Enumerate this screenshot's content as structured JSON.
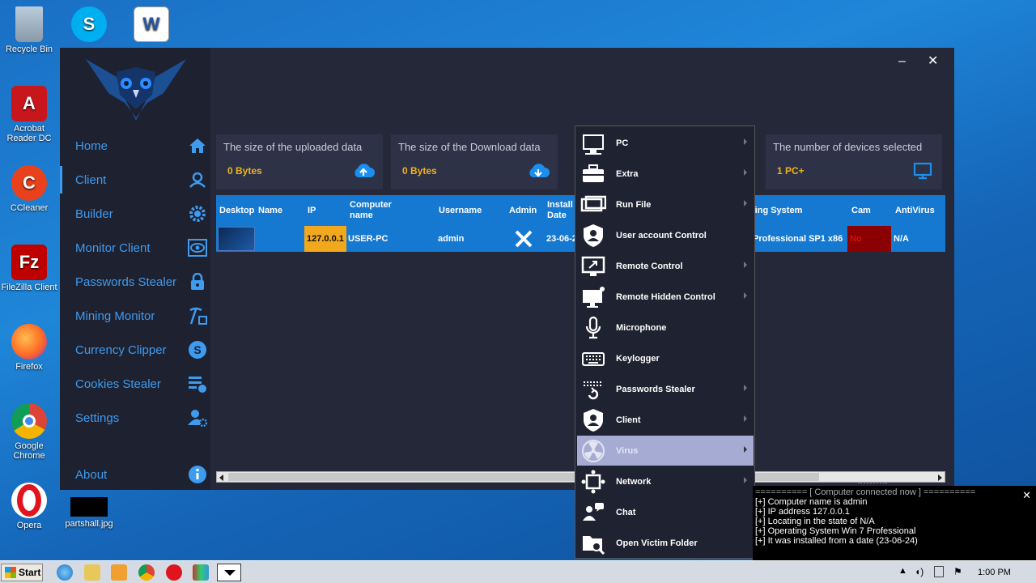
{
  "desktop": {
    "icons": [
      {
        "label": "Recycle Bin"
      },
      {
        "label": ""
      },
      {
        "label": ""
      },
      {
        "label": "Acrobat Reader DC"
      },
      {
        "label": "CCleaner"
      },
      {
        "label": "FileZilla Client"
      },
      {
        "label": "Firefox"
      },
      {
        "label": "Google Chrome"
      },
      {
        "label": "Opera"
      },
      {
        "label": "partshall.jpg"
      }
    ]
  },
  "window": {
    "minimize": "–",
    "close": "✕"
  },
  "sidebar": {
    "items": [
      {
        "label": "Home",
        "icon": "home-icon"
      },
      {
        "label": "Client",
        "icon": "user-icon"
      },
      {
        "label": "Builder",
        "icon": "gear-icon"
      },
      {
        "label": "Monitor Client",
        "icon": "eye-icon"
      },
      {
        "label": "Passwords Stealer",
        "icon": "lock-icon"
      },
      {
        "label": "Mining Monitor",
        "icon": "pickaxe-icon"
      },
      {
        "label": "Currency Clipper",
        "icon": "coin-icon"
      },
      {
        "label": "Cookies Stealer",
        "icon": "list-icon"
      },
      {
        "label": "Settings",
        "icon": "user-settings-icon"
      },
      {
        "label": "About",
        "icon": "info-icon"
      }
    ]
  },
  "stats": [
    {
      "title": "The size of the uploaded data",
      "value": "0 Bytes",
      "icon": "cloud-upload-icon"
    },
    {
      "title": "The size of the Download data",
      "value": "0 Bytes",
      "icon": "cloud-download-icon"
    },
    {
      "title": "The number of devices selected",
      "value": "1 PC+",
      "icon": "monitor-icon"
    }
  ],
  "table": {
    "headers": [
      "Desktop",
      "Name",
      "IP",
      "Computer name",
      "Username",
      "Admin",
      "Install Date",
      "ting System",
      "Cam",
      "AntiVirus"
    ],
    "row": {
      "name": "",
      "ip": "127.0.0.1",
      "computer_name": "USER-PC",
      "username": "admin",
      "install_date": "23-06-2",
      "os": "Professional SP1 x86",
      "cam": "No",
      "antivirus": "N/A"
    }
  },
  "context_menu": {
    "items": [
      {
        "label": "PC",
        "submenu": true
      },
      {
        "label": "Extra",
        "submenu": true
      },
      {
        "label": "Run File",
        "submenu": true
      },
      {
        "label": "User account Control",
        "submenu": false
      },
      {
        "label": "Remote Control",
        "submenu": true
      },
      {
        "label": "Remote Hidden Control",
        "submenu": true
      },
      {
        "label": "Microphone",
        "submenu": false
      },
      {
        "label": "Keylogger",
        "submenu": false
      },
      {
        "label": "Passwords Stealer",
        "submenu": true
      },
      {
        "label": "Client",
        "submenu": true
      },
      {
        "label": "Virus",
        "submenu": true
      },
      {
        "label": "Network",
        "submenu": true
      },
      {
        "label": "Chat",
        "submenu": false
      },
      {
        "label": "Open Victim Folder",
        "submenu": false
      }
    ]
  },
  "notification": {
    "header": "========== [ Computer connected now ] ==========",
    "lines": [
      "[+] Computer name is admin",
      "[+] IP address 127.0.0.1",
      "[+] Locating in the state of N/A",
      "[+] Operating System Win 7 Professional",
      "[+] It was installed from a date (23-06-24)"
    ]
  },
  "taskbar": {
    "start": "Start",
    "clock": "1:00 PM"
  },
  "colors": {
    "accent": "#3d9bf0",
    "gold": "#f2b31b",
    "table_blue": "#1579d2",
    "menu_highlight": "#a6abd3"
  }
}
